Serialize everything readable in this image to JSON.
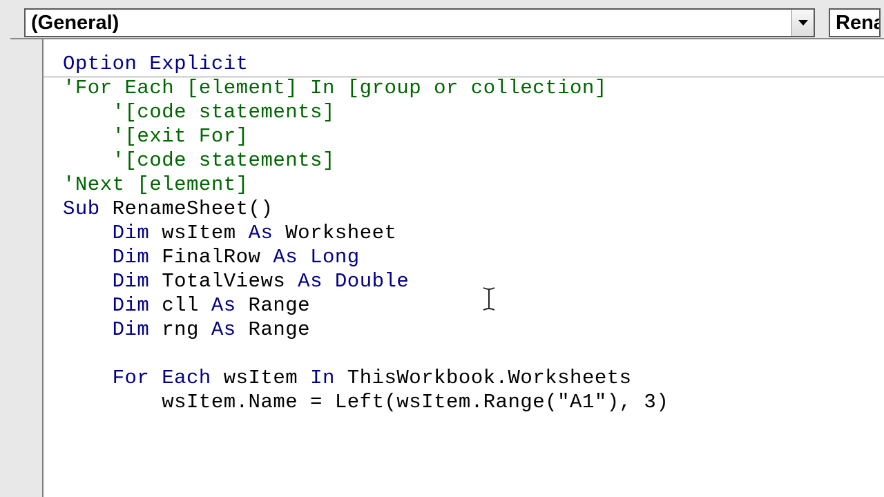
{
  "dropdowns": {
    "object": "(General)",
    "procedure": "Renam"
  },
  "code": {
    "l1_option": "Option Explicit",
    "l2": "'For Each [element] In [group or collection]",
    "l3": "    '[code statements]",
    "l4": "    '[exit For]",
    "l5": "    '[code statements]",
    "l6": "'Next [element]",
    "l7_sub": "Sub",
    "l7_name": " RenameSheet()",
    "l8_dim": "    Dim",
    "l8_rest": " wsItem ",
    "l8_as": "As",
    "l8_type": " Worksheet",
    "l9_dim": "    Dim",
    "l9_rest": " FinalRow ",
    "l9_as": "As",
    "l9_type": " Long",
    "l10_dim": "    Dim",
    "l10_rest": " TotalViews ",
    "l10_as": "As",
    "l10_type": " Double",
    "l11_dim": "    Dim",
    "l11_rest": " cll ",
    "l11_as": "As",
    "l11_type": " Range",
    "l12_dim": "    Dim",
    "l12_rest": " rng ",
    "l12_as": "As",
    "l12_type": " Range",
    "l13": "",
    "l14_for": "    For Each",
    "l14_mid": " wsItem ",
    "l14_in": "In",
    "l14_rest": " ThisWorkbook.Worksheets",
    "l15": "        wsItem.Name = Left(wsItem.Range(\"A1\"), 3)"
  }
}
